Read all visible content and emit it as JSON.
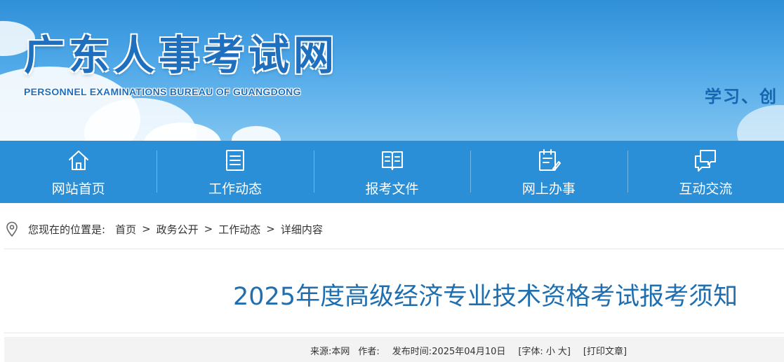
{
  "header": {
    "site_title": "广东人事考试网",
    "site_subtitle": "PERSONNEL EXAMINATIONS BUREAU OF GUANGDONG",
    "slogan": "学习、创"
  },
  "nav": {
    "items": [
      {
        "label": "网站首页",
        "icon": "home-icon"
      },
      {
        "label": "工作动态",
        "icon": "document-list-icon"
      },
      {
        "label": "报考文件",
        "icon": "open-book-icon"
      },
      {
        "label": "网上办事",
        "icon": "clipboard-edit-icon"
      },
      {
        "label": "互动交流",
        "icon": "chat-bubbles-icon"
      }
    ]
  },
  "breadcrumb": {
    "prefix": "您现在的位置是:",
    "items": [
      "首页",
      "政务公开",
      "工作动态",
      "详细内容"
    ],
    "separator": ">"
  },
  "article": {
    "title": "2025年度高级经济专业技术资格考试报考须知",
    "meta": {
      "source_label": "来源:",
      "source_value": "本网",
      "author_label": "作者:",
      "date_label": "发布时间:",
      "date_value": "2025年04月10日",
      "font_label": "[字体:",
      "font_small": "小",
      "font_large": "大]",
      "print_label": "[打印文章]"
    }
  },
  "colors": {
    "nav_background": "#2a8fd6",
    "title_blue": "#1f6fb0",
    "banner_top": "#2f8fd8"
  }
}
